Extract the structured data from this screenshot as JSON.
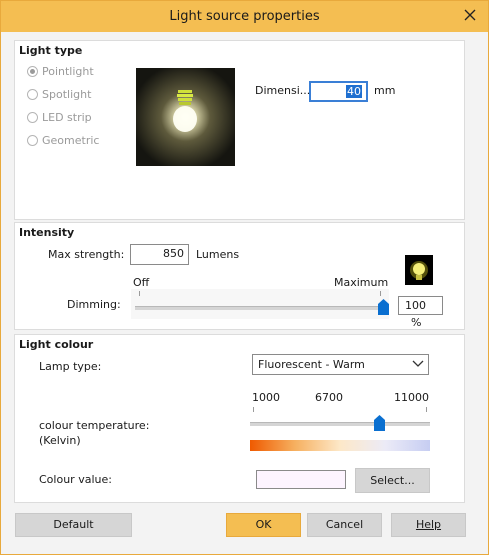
{
  "window": {
    "title": "Light source properties"
  },
  "light_type": {
    "heading": "Light type",
    "options": [
      {
        "label": "Pointlight",
        "selected": true
      },
      {
        "label": "Spotlight",
        "selected": false
      },
      {
        "label": "LED strip",
        "selected": false
      },
      {
        "label": "Geometric",
        "selected": false
      }
    ],
    "preview_image": "bulb-glow-preview",
    "dimension_label": "Dimensi...",
    "dimension_value": "40",
    "dimension_unit": "mm"
  },
  "intensity": {
    "heading": "Intensity",
    "max_strength_label": "Max strength:",
    "max_strength_value": "850",
    "max_strength_unit": "Lumens",
    "dimming_label": "Dimming:",
    "dimming_min_label": "Off",
    "dimming_max_label": "Maximum",
    "dimming_level_percent": 100,
    "dimming_value": "100",
    "dimming_unit": "%",
    "bulb_icon": "small-bulb-icon"
  },
  "light_colour": {
    "heading": "Light colour",
    "lamp_type_label": "Lamp type:",
    "lamp_type_value": "Fluorescent - Warm",
    "colour_temp_label_line1": "colour temperature:",
    "colour_temp_label_line2": "(Kelvin)",
    "temp_scale": [
      "1000",
      "6700",
      "11000"
    ],
    "temp_value_kelvin": 8300,
    "temp_min": 1000,
    "temp_max": 11000,
    "gradient_colors": [
      "#ef5a00",
      "#f6b060",
      "#fde8c8",
      "#ecebf7",
      "#c6cdf2"
    ],
    "colour_value_label": "Colour value:",
    "colour_swatch": "#fdf4ff",
    "select_button": "Select..."
  },
  "footer": {
    "default_button": "Default",
    "ok_button": "OK",
    "cancel_button": "Cancel",
    "help_button": "Help"
  },
  "colors": {
    "accent": "#f4be52",
    "slider_thumb": "#0a6fd0"
  }
}
